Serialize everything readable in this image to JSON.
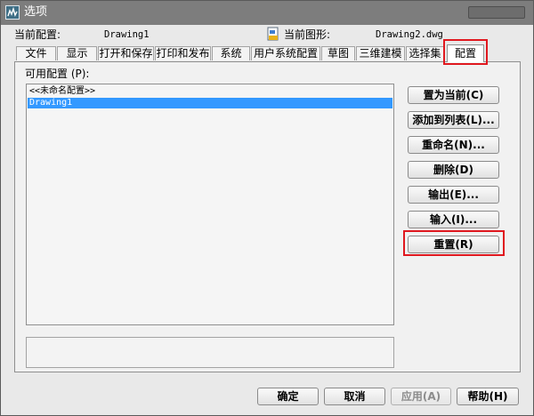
{
  "window": {
    "title": "选项"
  },
  "header": {
    "current_profile_label": "当前配置:",
    "current_profile_value": "Drawing1",
    "current_drawing_label": "当前图形:",
    "current_drawing_value": "Drawing2.dwg"
  },
  "tabs": [
    {
      "label": "文件",
      "active": false
    },
    {
      "label": "显示",
      "active": false
    },
    {
      "label": "打开和保存",
      "active": false
    },
    {
      "label": "打印和发布",
      "active": false
    },
    {
      "label": "系统",
      "active": false
    },
    {
      "label": "用户系统配置",
      "active": false
    },
    {
      "label": "草图",
      "active": false
    },
    {
      "label": "三维建模",
      "active": false
    },
    {
      "label": "选择集",
      "active": false
    },
    {
      "label": "配置",
      "active": true
    }
  ],
  "profiles": {
    "label": "可用配置 (P):",
    "items": [
      {
        "label": "<<未命名配置>>",
        "selected": false
      },
      {
        "label": "Drawing1",
        "selected": true
      }
    ]
  },
  "actions": {
    "set_current": "置为当前(C)",
    "add_to_list": "添加到列表(L)...",
    "rename": "重命名(N)...",
    "delete": "删除(D)",
    "export": "输出(E)...",
    "import": "输入(I)...",
    "reset": "重置(R)"
  },
  "footer": {
    "ok": "确定",
    "cancel": "取消",
    "apply": "应用(A)",
    "help": "帮助(H)"
  },
  "colors": {
    "selection": "#3399ff",
    "highlight_annotation": "#e0181f",
    "titlebar": "#7d7d7d"
  }
}
